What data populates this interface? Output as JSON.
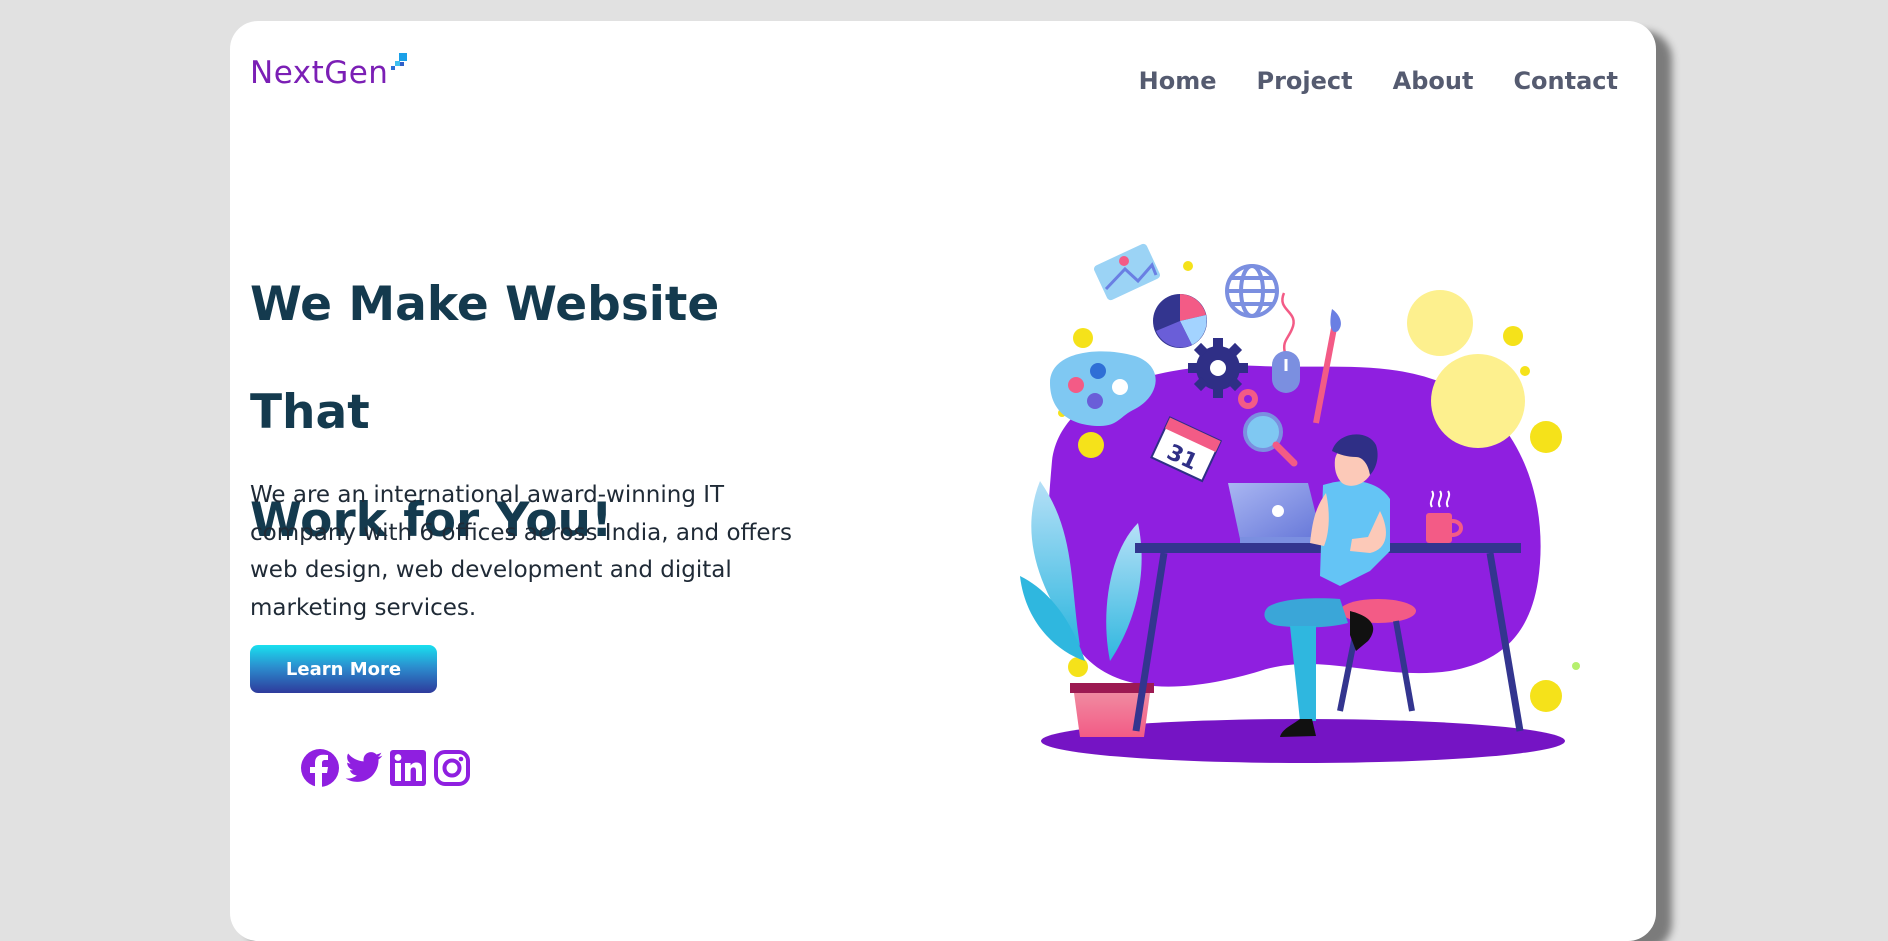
{
  "brand": {
    "name": "NextGen",
    "color": "#7b1fb5"
  },
  "nav": [
    {
      "label": "Home"
    },
    {
      "label": "Project"
    },
    {
      "label": "About"
    },
    {
      "label": "Contact"
    }
  ],
  "hero": {
    "headline_line1": "We Make Website That",
    "headline_line2": "Work for You!",
    "description": "We are an international award-winning IT company with 6 offices across India, and offers web design, web development and digital marketing services.",
    "cta_label": "Learn More",
    "illustration_calendar_day": "31"
  },
  "social": [
    {
      "icon": "facebook-icon"
    },
    {
      "icon": "twitter-icon"
    },
    {
      "icon": "linkedin-icon"
    },
    {
      "icon": "instagram-icon"
    }
  ],
  "colors": {
    "background": "#e1e1e1",
    "card": "#ffffff",
    "heading": "#143a4e",
    "nav": "#555b70",
    "accent_purple": "#8f1fe0",
    "button_gradient": [
      "#19e0ef",
      "#2e3a9c"
    ]
  }
}
